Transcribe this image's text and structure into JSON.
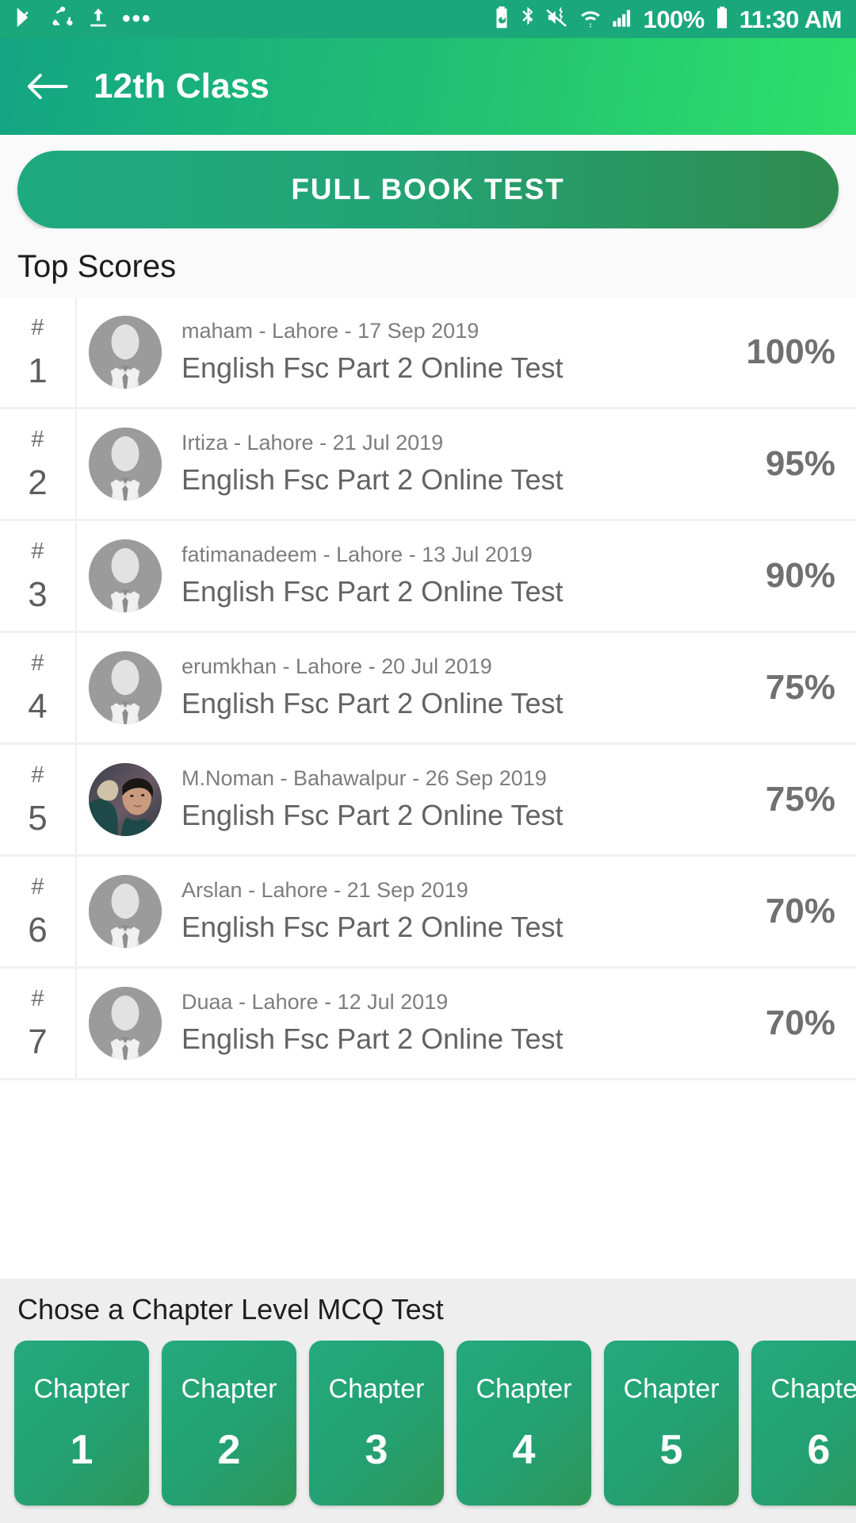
{
  "status_bar": {
    "left_icons": [
      "playstore-check-icon",
      "share-sync-icon",
      "upload-icon",
      "more-dots-icon"
    ],
    "right_icons": [
      "battery-saver-icon",
      "bluetooth-icon",
      "vibrate-mute-icon",
      "wifi-icon",
      "signal-bars-icon"
    ],
    "battery_percent": "100%",
    "time": "11:30 AM",
    "background_color": "#1aa87a"
  },
  "app_bar": {
    "back_icon": "arrow-left-icon",
    "title": "12th Class",
    "gradient_from": "#13a583",
    "gradient_to": "#2ee06a"
  },
  "full_book_test": {
    "label": "FULL BOOK TEST",
    "gradient_from": "#1fa97e",
    "gradient_to": "#2f8b4f"
  },
  "top_scores": {
    "heading": "Top Scores",
    "rank_symbol": "#",
    "rows": [
      {
        "rank": "1",
        "meta": "maham - Lahore - 17 Sep 2019",
        "title": "English Fsc Part 2 Online Test",
        "score": "100%",
        "avatar": "default-person-avatar"
      },
      {
        "rank": "2",
        "meta": "Irtiza - Lahore - 21 Jul 2019",
        "title": "English Fsc Part 2 Online Test",
        "score": "95%",
        "avatar": "default-person-avatar"
      },
      {
        "rank": "3",
        "meta": "fatimanadeem - Lahore - 13 Jul 2019",
        "title": "English Fsc Part 2 Online Test",
        "score": "90%",
        "avatar": "default-person-avatar"
      },
      {
        "rank": "4",
        "meta": "erumkhan - Lahore - 20 Jul 2019",
        "title": "English Fsc Part 2 Online Test",
        "score": "75%",
        "avatar": "default-person-avatar"
      },
      {
        "rank": "5",
        "meta": "M.Noman - Bahawalpur - 26 Sep 2019",
        "title": "English Fsc Part 2 Online Test",
        "score": "75%",
        "avatar": "user-photo-avatar"
      },
      {
        "rank": "6",
        "meta": "Arslan - Lahore - 21 Sep 2019",
        "title": "English Fsc Part 2 Online Test",
        "score": "70%",
        "avatar": "default-person-avatar"
      },
      {
        "rank": "7",
        "meta": "Duaa - Lahore - 12 Jul 2019",
        "title": "English Fsc Part 2 Online Test",
        "score": "70%",
        "avatar": "default-person-avatar"
      }
    ]
  },
  "chapters": {
    "heading": "Chose a Chapter Level MCQ Test",
    "card_label": "Chapter",
    "items": [
      {
        "label": "Chapter",
        "number": "1"
      },
      {
        "label": "Chapter",
        "number": "2"
      },
      {
        "label": "Chapter",
        "number": "3"
      },
      {
        "label": "Chapter",
        "number": "4"
      },
      {
        "label": "Chapter",
        "number": "5"
      },
      {
        "label": "Chapter",
        "number": "6"
      }
    ],
    "background_color": "#eeeeee",
    "card_gradient_from": "#24a97d",
    "card_gradient_to": "#2f9657"
  }
}
